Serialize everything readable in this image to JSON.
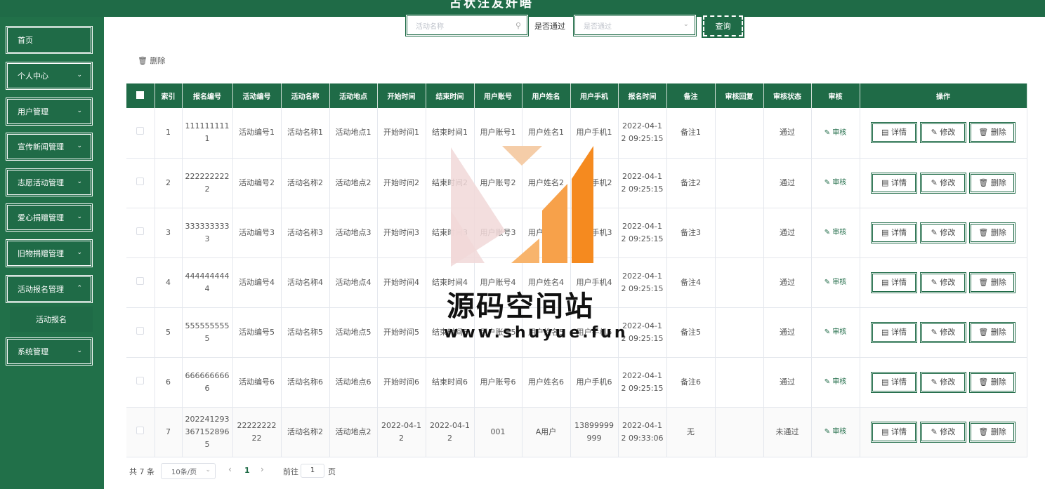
{
  "header": {
    "title": "占状汪友奸晤"
  },
  "sidebar": {
    "items": [
      {
        "label": "首页",
        "arrow": ""
      },
      {
        "label": "个人中心",
        "arrow": "⌄"
      },
      {
        "label": "用户管理",
        "arrow": "⌄"
      },
      {
        "label": "宣传新闻管理",
        "arrow": "⌄"
      },
      {
        "label": "志愿活动管理",
        "arrow": "⌄"
      },
      {
        "label": "爱心捐赠管理",
        "arrow": "⌄"
      },
      {
        "label": "旧物捐赠管理",
        "arrow": "⌄"
      },
      {
        "label": "活动报名管理",
        "arrow": "⌃"
      },
      {
        "label": "系统管理",
        "arrow": "⌄"
      }
    ],
    "submenu": {
      "label": "活动报名"
    }
  },
  "filters": {
    "search_placeholder": "活动名称",
    "pass_label": "是否通过",
    "pass_placeholder": "是否通过",
    "query_label": "查询"
  },
  "toolbar": {
    "delete_label": "删除"
  },
  "table": {
    "headers": [
      "",
      "索引",
      "报名编号",
      "活动编号",
      "活动名称",
      "活动地点",
      "开始时间",
      "结束时间",
      "用户账号",
      "用户姓名",
      "用户手机",
      "报名时间",
      "备注",
      "审核回复",
      "审核状态",
      "审核",
      "操作"
    ],
    "rows": [
      {
        "index": "1",
        "reg_no": "1111111111",
        "act_no": "活动编号1",
        "act_name": "活动名称1",
        "place": "活动地点1",
        "start": "开始时间1",
        "end": "结束时间1",
        "account": "用户账号1",
        "name": "用户姓名1",
        "phone": "用户手机1",
        "reg_time": "2022-04-12 09:25:15",
        "remark": "备注1",
        "reply": "",
        "status": "通过"
      },
      {
        "index": "2",
        "reg_no": "2222222222",
        "act_no": "活动编号2",
        "act_name": "活动名称2",
        "place": "活动地点2",
        "start": "开始时间2",
        "end": "结束时间2",
        "account": "用户账号2",
        "name": "用户姓名2",
        "phone": "用户手机2",
        "reg_time": "2022-04-12 09:25:15",
        "remark": "备注2",
        "reply": "",
        "status": "通过"
      },
      {
        "index": "3",
        "reg_no": "3333333333",
        "act_no": "活动编号3",
        "act_name": "活动名称3",
        "place": "活动地点3",
        "start": "开始时间3",
        "end": "结束时间3",
        "account": "用户账号3",
        "name": "用户姓名3",
        "phone": "用户手机3",
        "reg_time": "2022-04-12 09:25:15",
        "remark": "备注3",
        "reply": "",
        "status": "通过"
      },
      {
        "index": "4",
        "reg_no": "4444444444",
        "act_no": "活动编号4",
        "act_name": "活动名称4",
        "place": "活动地点4",
        "start": "开始时间4",
        "end": "结束时间4",
        "account": "用户账号4",
        "name": "用户姓名4",
        "phone": "用户手机4",
        "reg_time": "2022-04-12 09:25:15",
        "remark": "备注4",
        "reply": "",
        "status": "通过"
      },
      {
        "index": "5",
        "reg_no": "5555555555",
        "act_no": "活动编号5",
        "act_name": "活动名称5",
        "place": "活动地点5",
        "start": "开始时间5",
        "end": "结束时间5",
        "account": "用户账号5",
        "name": "用户姓名5",
        "phone": "用户手机5",
        "reg_time": "2022-04-12 09:25:15",
        "remark": "备注5",
        "reply": "",
        "status": "通过"
      },
      {
        "index": "6",
        "reg_no": "6666666666",
        "act_no": "活动编号6",
        "act_name": "活动名称6",
        "place": "活动地点6",
        "start": "开始时间6",
        "end": "结束时间6",
        "account": "用户账号6",
        "name": "用户姓名6",
        "phone": "用户手机6",
        "reg_time": "2022-04-12 09:25:15",
        "remark": "备注6",
        "reply": "",
        "status": "通过"
      },
      {
        "index": "7",
        "reg_no": "2022412933671528965",
        "act_no": "2222222222",
        "act_name": "活动名称2",
        "place": "活动地点2",
        "start": "2022-04-12",
        "end": "2022-04-12",
        "account": "001",
        "name": "A用户",
        "phone": "13899999999",
        "reg_time": "2022-04-12 09:33:06",
        "remark": "无",
        "reply": "",
        "status": "未通过"
      }
    ],
    "audit_label": "审核",
    "detail_label": "详情",
    "edit_label": "修改",
    "delete_label": "删除"
  },
  "pagination": {
    "total": "共 7 条",
    "page_size": "10条/页",
    "current": "1",
    "goto_label": "前往",
    "goto_value": "1",
    "page_label": "页"
  },
  "watermark": {
    "text": "源码空间站",
    "url": "www.shuyue.fun"
  },
  "colors": {
    "primary": "#1f6b47",
    "sidebar": "#217049",
    "watermark_orange": "#f58a1f",
    "watermark_pink": "#f1d8d8"
  }
}
